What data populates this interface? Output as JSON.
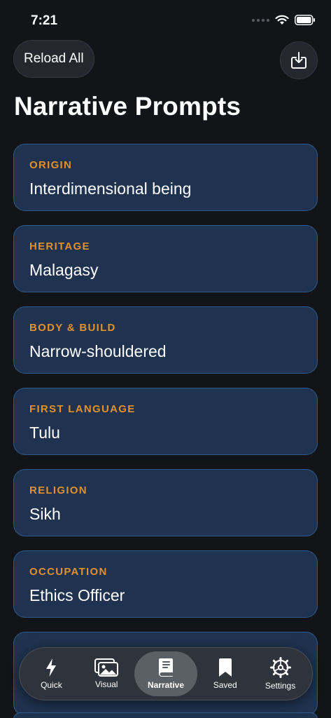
{
  "status": {
    "time": "7:21"
  },
  "toolbar": {
    "reload_label": "Reload All"
  },
  "page": {
    "title": "Narrative Prompts"
  },
  "cards": [
    {
      "label": "ORIGIN",
      "value": "Interdimensional being"
    },
    {
      "label": "HERITAGE",
      "value": "Malagasy"
    },
    {
      "label": "BODY & BUILD",
      "value": "Narrow-shouldered"
    },
    {
      "label": "FIRST LANGUAGE",
      "value": "Tulu"
    },
    {
      "label": "RELIGION",
      "value": "Sikh"
    },
    {
      "label": "OCCUPATION",
      "value": "Ethics Officer"
    }
  ],
  "tabs": [
    {
      "label": "Quick",
      "icon": "bolt-icon"
    },
    {
      "label": "Visual",
      "icon": "photos-icon"
    },
    {
      "label": "Narrative",
      "icon": "book-icon",
      "active": true
    },
    {
      "label": "Saved",
      "icon": "bookmark-icon"
    },
    {
      "label": "Settings",
      "icon": "gear-icon"
    }
  ],
  "colors": {
    "accent": "#e1902a",
    "card_bg": "#1f3350",
    "card_border": "#2f5a8e",
    "background": "#121418"
  }
}
